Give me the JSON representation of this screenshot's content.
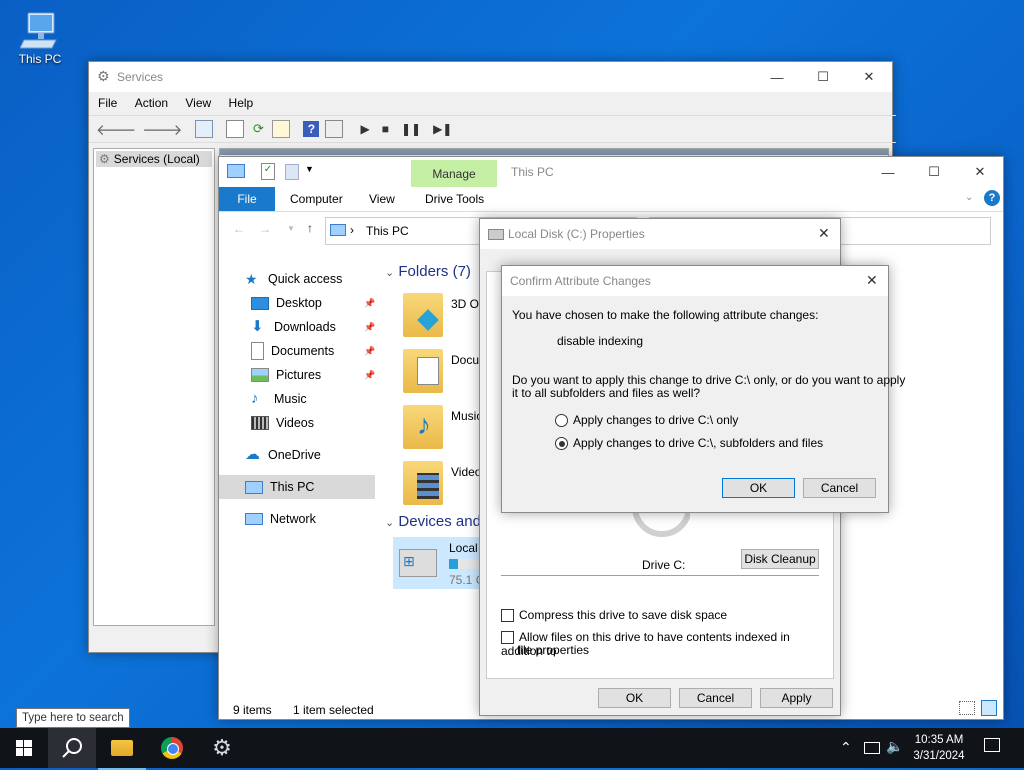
{
  "desktop": {
    "this_pc_label": "This PC"
  },
  "services": {
    "title": "Services",
    "menu": [
      "File",
      "Action",
      "View",
      "Help"
    ],
    "tree_item": "Services (Local)"
  },
  "explorer": {
    "title": "This PC",
    "ribbon_context": "Manage",
    "tabs": [
      "File",
      "Computer",
      "View",
      "Drive Tools"
    ],
    "address": "This PC",
    "nav": {
      "quick_access": "Quick access",
      "desktop": "Desktop",
      "downloads": "Downloads",
      "documents": "Documents",
      "pictures": "Pictures",
      "music": "Music",
      "videos": "Videos",
      "onedrive": "OneDrive",
      "this_pc": "This PC",
      "network": "Network"
    },
    "folders_header": "Folders (7)",
    "folders": [
      "3D Ob",
      "Docu",
      "Music",
      "Video"
    ],
    "devices_header": "Devices and",
    "drive": {
      "name": "Local",
      "free": "75.1 G",
      "used_fraction": 0.2
    },
    "status": {
      "items": "9 items",
      "selected": "1 item selected"
    }
  },
  "properties": {
    "title": "Local Disk (C:) Properties",
    "drive_label": "Drive C:",
    "disk_cleanup": "Disk Cleanup",
    "compress": "Compress this drive to save disk space",
    "index_line1": "Allow files on this drive to have contents indexed in addition to",
    "index_line2": "file properties",
    "ok": "OK",
    "cancel": "Cancel",
    "apply": "Apply"
  },
  "confirm": {
    "title": "Confirm Attribute Changes",
    "intro": "You have chosen to make the following attribute changes:",
    "change": "disable indexing",
    "question_line1": "Do you want to apply this change to drive C:\\ only, or do you want to apply",
    "question_line2": "it to all subfolders and files as well?",
    "option1": "Apply changes to drive C:\\ only",
    "option2": "Apply changes to drive C:\\, subfolders and files",
    "ok": "OK",
    "cancel": "Cancel"
  },
  "taskbar": {
    "search_tooltip": "Type here to search",
    "time": "10:35 AM",
    "date": "3/31/2024"
  },
  "colors": {
    "accent": "#0078d7",
    "manage_green": "#c6efa6",
    "taskbar": "#101419"
  }
}
